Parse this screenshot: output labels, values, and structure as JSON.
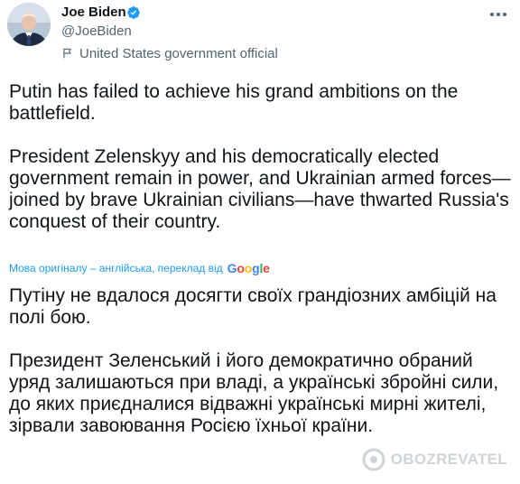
{
  "header": {
    "name": "Joe Biden",
    "handle": "@JoeBiden",
    "label": "United States government official"
  },
  "tweet": {
    "paragraphs": [
      "Putin has failed to achieve his grand ambitions on the battlefield.",
      "President Zelenskyy and his democratically elected government remain in power, and Ukrainian armed forces—joined by brave Ukrainian civilians—have thwarted Russia's conquest of their country."
    ]
  },
  "translation": {
    "note": "Мова оригіналу – англійська, переклад від",
    "provider": "Google",
    "paragraphs": [
      "Путіну не вдалося досягти своїх грандіозних амбіцій на полі бою.",
      "Президент Зеленський і його демократично обраний уряд залишаються при владі, а українські збройні сили, до яких приєдналися відважні українські мирні жителі, зірвали завоювання Росією їхньої країни."
    ]
  },
  "watermark": {
    "text": "OBOZREVATEL"
  },
  "colors": {
    "text_primary": "#0f1419",
    "text_secondary": "#536471",
    "link": "#1d9bf0",
    "verified": "#1d9bf0"
  },
  "icons": [
    "verified-badge-icon",
    "government-flag-icon",
    "more-options-icon",
    "google-logo",
    "watermark-logo-icon"
  ]
}
